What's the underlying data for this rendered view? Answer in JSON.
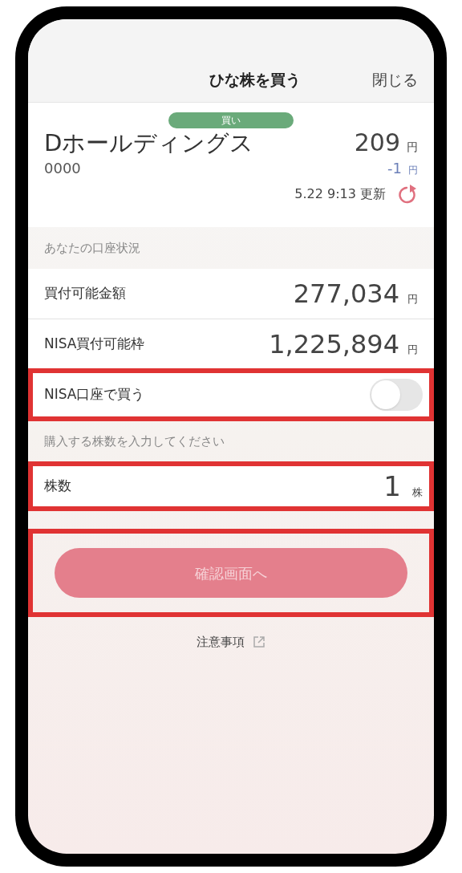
{
  "header": {
    "title": "ひな株を買う",
    "close": "閉じる"
  },
  "stock": {
    "badge": "買い",
    "name": "Dホールディングス",
    "code": "0000",
    "price": "209",
    "price_unit": "円",
    "change": "-1",
    "change_unit": "円",
    "updated": "5.22 9:13 更新"
  },
  "account": {
    "heading": "あなたの口座状況",
    "rows": [
      {
        "label": "買付可能金額",
        "value": "277,034",
        "unit": "円"
      },
      {
        "label": "NISA買付可能枠",
        "value": "1,225,894",
        "unit": "円"
      }
    ]
  },
  "nisa_toggle": {
    "label": "NISA口座で買う",
    "on": false,
    "highlighted": true
  },
  "quantity": {
    "heading": "購入する株数を入力してください",
    "label": "株数",
    "value": "1",
    "unit": "株",
    "highlighted": true
  },
  "confirm": {
    "label": "確認画面へ",
    "disabled": true,
    "highlighted": true
  },
  "notes_link": "注意事項"
}
